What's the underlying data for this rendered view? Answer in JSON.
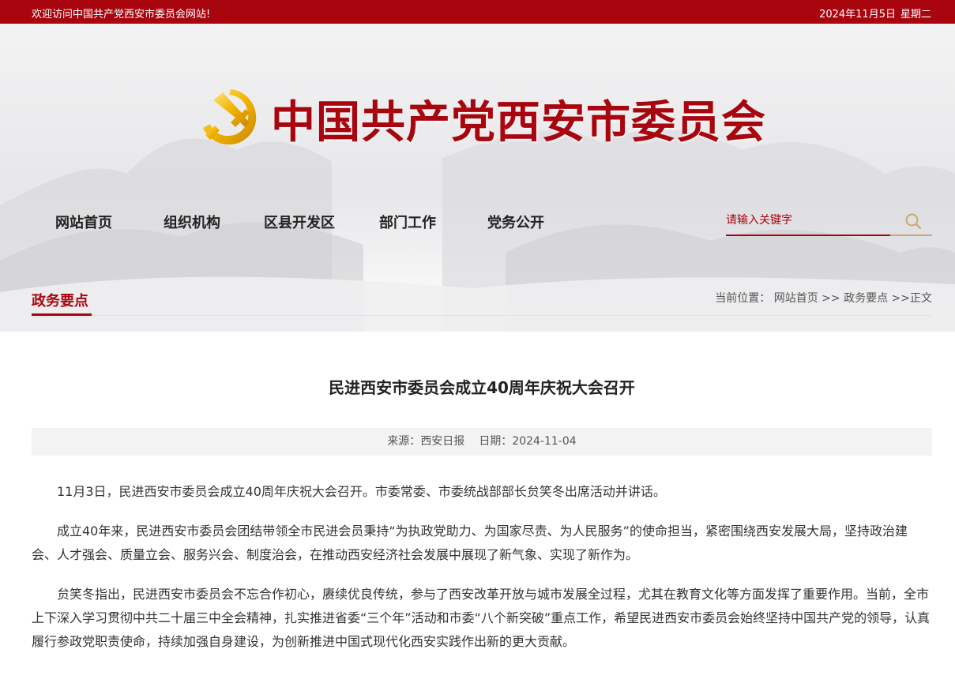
{
  "topbar": {
    "welcome": "欢迎访问中国共产党西安市委员会网站!",
    "date": "2024年11月5日",
    "weekday": "星期二"
  },
  "header": {
    "site_title": "中国共产党西安市委员会",
    "logo_icon": "party-emblem-icon"
  },
  "nav": {
    "items": [
      "网站首页",
      "组织机构",
      "区县开发区",
      "部门工作",
      "党务公开"
    ]
  },
  "search": {
    "placeholder": "请输入关键字",
    "icon": "search-icon"
  },
  "section": {
    "title": "政务要点"
  },
  "breadcrumb": {
    "label": "当前位置：",
    "home": "网站首页",
    "sep1": " >> ",
    "section": "政务要点",
    "sep2": " >>",
    "current": "正文"
  },
  "article": {
    "title": "民进西安市委员会成立40周年庆祝大会召开",
    "source_label": "来源：",
    "source": "西安日报",
    "date_label": "日期：",
    "date": "2024-11-04",
    "paragraphs": [
      "11月3日，民进西安市委员会成立40周年庆祝大会召开。市委常委、市委统战部部长贠笑冬出席活动并讲话。",
      "成立40年来，民进西安市委员会团结带领全市民进会员秉持“为执政党助力、为国家尽责、为人民服务”的使命担当，紧密围绕西安发展大局，坚持政治建会、人才强会、质量立会、服务兴会、制度治会，在推动西安经济社会发展中展现了新气象、实现了新作为。",
      "贠笑冬指出，民进西安市委员会不忘合作初心，赓续优良传统，参与了西安改革开放与城市发展全过程，尤其在教育文化等方面发挥了重要作用。当前，全市上下深入学习贯彻中共二十届三中全会精神，扎实推进省委“三个年”活动和市委“八个新突破”重点工作，希望民进西安市委员会始终坚持中国共产党的领导，认真履行参政党职责使命，持续加强自身建设，为创新推进中国式现代化西安实践作出新的更大贡献。"
    ]
  },
  "colors": {
    "brand_red": "#a9050f",
    "gold": "#c9a86a"
  }
}
